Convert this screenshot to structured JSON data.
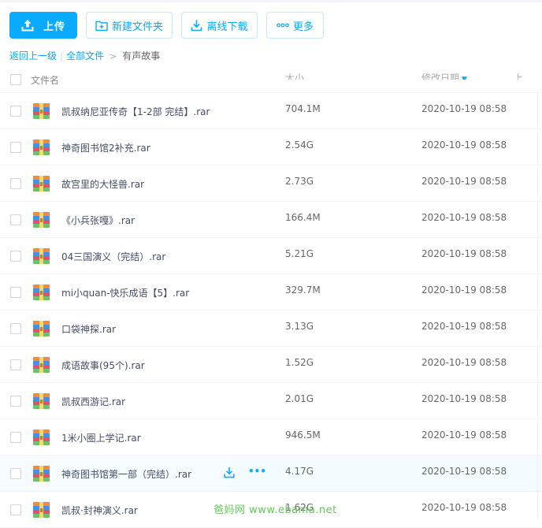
{
  "toolbar": {
    "upload_label": "上传",
    "new_folder_label": "新建文件夹",
    "offline_download_label": "离线下载",
    "more_label": "更多"
  },
  "breadcrumb": {
    "back_label": "返回上一级",
    "separator": "|",
    "all_files_label": "全部文件",
    "arrow": ">",
    "current_label": "有声故事"
  },
  "table": {
    "header_name": "文件名",
    "header_size": "大小",
    "header_date": "修改日期",
    "header_sort_glyph": "▼",
    "header_extra": "上"
  },
  "files": [
    {
      "name": "凯叔纳尼亚传奇【1-2部 完结】.rar",
      "size": "704.1M",
      "date": "2020-10-19 08:58"
    },
    {
      "name": "神奇图书馆2补充.rar",
      "size": "2.54G",
      "date": "2020-10-19 08:58"
    },
    {
      "name": "故宫里的大怪兽.rar",
      "size": "2.73G",
      "date": "2020-10-19 08:58"
    },
    {
      "name": "《小兵张嘎》.rar",
      "size": "166.4M",
      "date": "2020-10-19 08:58"
    },
    {
      "name": "04三国演义（完结）.rar",
      "size": "5.21G",
      "date": "2020-10-19 08:58"
    },
    {
      "name": "mi小quan-快乐成语【5】.rar",
      "size": "329.7M",
      "date": "2020-10-19 08:58"
    },
    {
      "name": "口袋神探.rar",
      "size": "3.13G",
      "date": "2020-10-19 08:58"
    },
    {
      "name": "成语故事(95个).rar",
      "size": "1.52G",
      "date": "2020-10-19 08:58"
    },
    {
      "name": "凯叔西游记.rar",
      "size": "2.01G",
      "date": "2020-10-19 08:58"
    },
    {
      "name": "1米小圈上学记.rar",
      "size": "946.5M",
      "date": "2020-10-19 08:58"
    },
    {
      "name": "神奇图书馆第一部（完结）.rar",
      "size": "4.17G",
      "date": "2020-10-19 08:58"
    },
    {
      "name": "凯叔·封神演义.rar",
      "size": "1.62G",
      "date": "2020-10-19 08:58"
    }
  ],
  "row_actions": {
    "more_glyph": "•••"
  },
  "watermark": "爸妈网 www.ebama.net",
  "colors": {
    "accent": "#09aaff",
    "hover_row": "#f4fbff",
    "watermark": "#63c95a"
  },
  "icons": {
    "upload": "upload-icon",
    "new_folder": "new-folder-icon",
    "download": "download-icon",
    "more": "more-dots-icon",
    "file": "rar-archive-icon"
  }
}
